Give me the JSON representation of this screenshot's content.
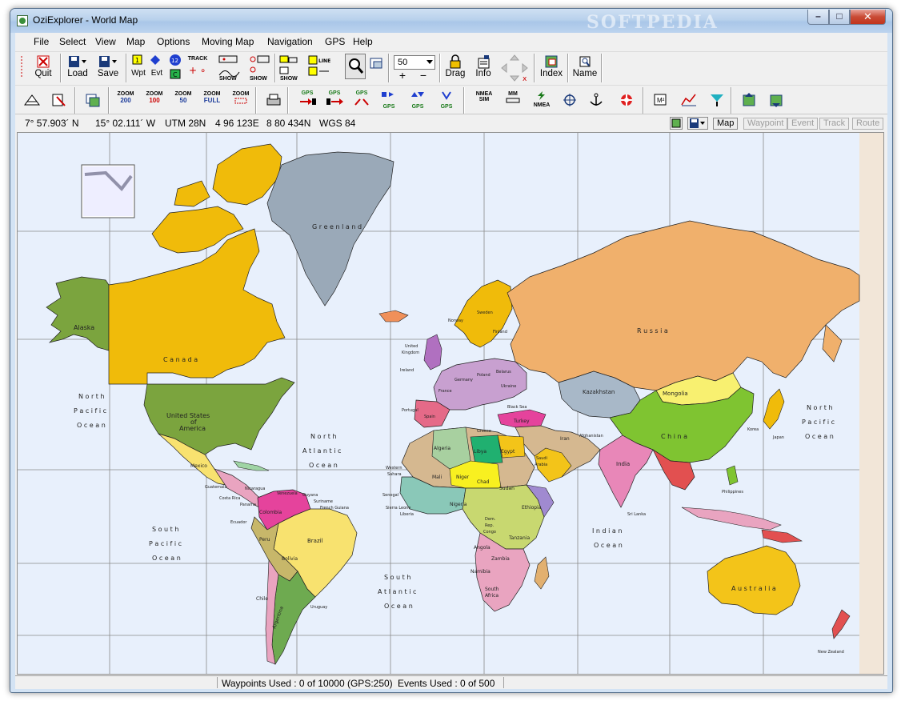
{
  "window": {
    "title": "OziExplorer - World Map",
    "watermark": "SOFTPEDIA",
    "minimize": "–",
    "maximize": "□",
    "close": "✕"
  },
  "menu": [
    "File",
    "Select",
    "View",
    "Map",
    "Options",
    "Moving Map",
    "Navigation",
    "GPS",
    "Help"
  ],
  "toolbar1": {
    "quit": "Quit",
    "load": "Load",
    "save": "Save",
    "wpt": "Wpt",
    "evt": "Evt",
    "track": "TRACK",
    "show": "SHOW",
    "line": "LINE",
    "zoom_value": "50",
    "drag": "Drag",
    "info": "Info",
    "index": "Index",
    "name": "Name"
  },
  "toolbar2": {
    "zoom200": [
      "ZOOM",
      "200"
    ],
    "zoom100": [
      "ZOOM",
      "100"
    ],
    "zoom50": [
      "ZOOM",
      "50"
    ],
    "zoomfull": [
      "ZOOM",
      "FULL"
    ],
    "zoomsel": [
      "ZOOM",
      ""
    ],
    "gps": "GPS",
    "nmea_sim": [
      "NMEA",
      "SIM"
    ],
    "mm": "MM",
    "nmea": "NMEA",
    "m2": "M²"
  },
  "coords": {
    "lat": "7° 57.903´ N",
    "lon": "15° 02.111´ W",
    "utm_zone": "UTM  28N",
    "easting": "4 96 123E",
    "northing": "8 80 434N",
    "datum": "WGS 84"
  },
  "modes": {
    "map": "Map",
    "waypoint": "Waypoint",
    "event": "Event",
    "track": "Track",
    "route": "Route"
  },
  "status": {
    "waypoints": "Waypoints Used : 0 of 10000  (GPS:250)",
    "events": "Events Used : 0 of 500"
  },
  "map_labels": {
    "greenland": "G r e e n l a n d",
    "alaska": "Alaska",
    "canada": "C a n a d a",
    "usa1": "United States",
    "usa2": "of",
    "usa3": "America",
    "mexico": "Mexico",
    "russia": "R u s s i a",
    "mongolia": "Mongolia",
    "kazakhstan": "Kazakhstan",
    "china": "C h i n a",
    "india": "India",
    "afghanistan": "Afghanistan",
    "iran": "Iran",
    "turkey": "Turkey",
    "egypt": "Egypt",
    "libya": "Libya",
    "algeria": "Algeria",
    "sudan": "Sudan",
    "chad": "Chad",
    "niger": "Niger",
    "mali": "Mali",
    "nigeria": "Nigeria",
    "ethiopia": "Ethiopia",
    "tanzania": "Tanzania",
    "angola": "Angola",
    "zambia": "Zambia",
    "namibia": "Namibia",
    "south_africa1": "South",
    "south_africa2": "Africa",
    "congo1": "Dem.",
    "congo2": "Rep.",
    "congo3": "Congo",
    "saudi1": "Saudi",
    "saudi2": "Arabia",
    "brazil": "Brazil",
    "bolivia": "Bolivia",
    "peru": "Peru",
    "colombia": "Colombia",
    "venezuela": "Venezuela",
    "argentina": "Argentina",
    "chile": "Chile",
    "uruguay": "Uruguay",
    "ecuador": "Ecuador",
    "guyana": "Guyana",
    "suriname": "Suriname",
    "french_guiana": "French Guiana",
    "guatemala": "Guatemala",
    "nicaragua": "Nicaragua",
    "costa_rica": "Costa Rica",
    "panama": "Panama",
    "australia": "A u s t r a l i a",
    "japan": "Japan",
    "korea": "Korea",
    "philippines": "Philippines",
    "new_zealand": "New Zealand",
    "uk1": "United",
    "uk2": "Kingdom",
    "ireland": "Ireland",
    "france": "France",
    "spain": "Spain",
    "portugal": "Portugal",
    "germany": "Germany",
    "poland": "Poland",
    "belarus": "Belarus",
    "ukraine": "Ukraine",
    "greece": "Greece",
    "sweden": "Sweden",
    "norway": "Norway",
    "finland": "Finland",
    "black_sea": "Black Sea",
    "western_sahara1": "Western",
    "western_sahara2": "Sahara",
    "senegal": "Senegal",
    "sierra_leone": "Sierra Leone",
    "liberia": "Liberia",
    "sri_lanka": "Sri Lanka",
    "north_pacific": [
      "N o r t h",
      "P a c i f i c",
      "O c e a n"
    ],
    "north_pacific_east": [
      "N o r t h",
      "P a c i f i c",
      "O c e a n"
    ],
    "north_atlantic": [
      "N o r t h",
      "A t l a n t i c",
      "O c e a n"
    ],
    "south_pacific": [
      "S o u t h",
      "P a c i f i c",
      "O c e a n"
    ],
    "south_atlantic": [
      "S o u t h",
      "A t l a n t i c",
      "O c e a n"
    ],
    "indian_ocean": [
      "I n d i a n",
      "O c e a n"
    ]
  },
  "colors": {
    "ocean": "#e8f0fc",
    "canada": "#f0bb0a",
    "usa": "#7ba43e",
    "greenland": "#9aa9b8",
    "russia": "#f0b06c",
    "china": "#7fc431",
    "australia": "#f3c419",
    "brazil": "#f8e26f"
  }
}
